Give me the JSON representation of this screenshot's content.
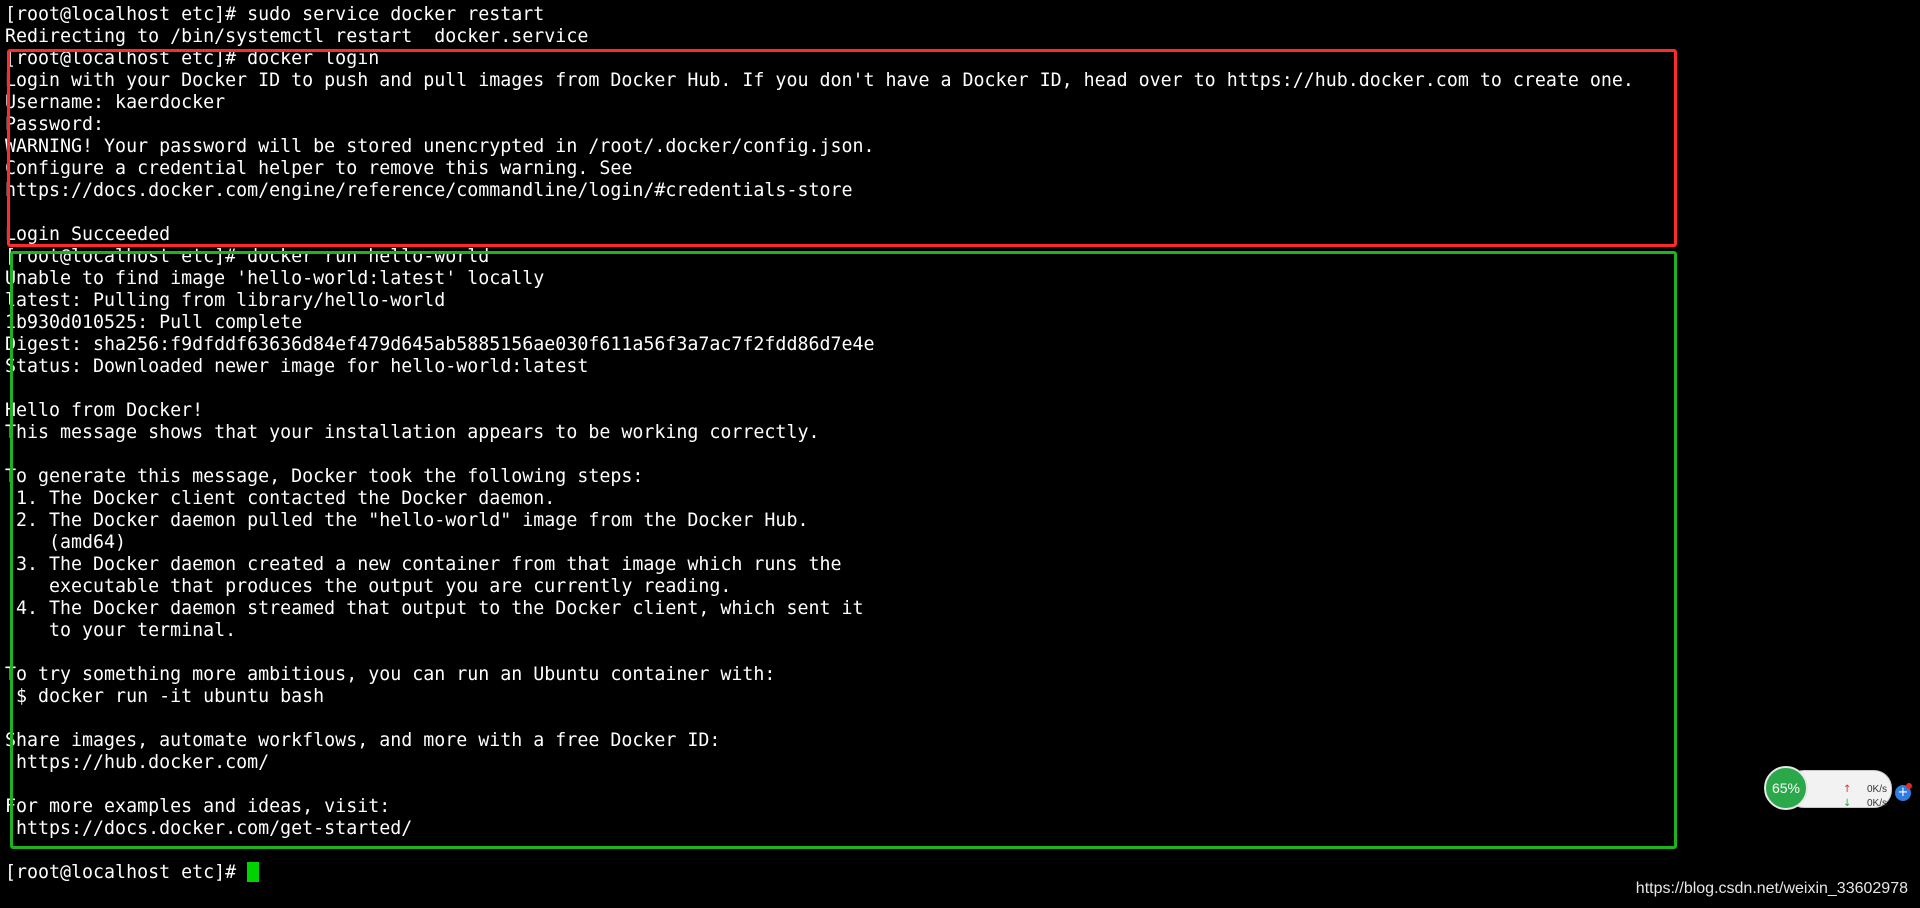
{
  "terminal": {
    "lines": [
      "[root@localhost etc]# sudo service docker restart",
      "Redirecting to /bin/systemctl restart  docker.service",
      "[root@localhost etc]# docker login",
      "Login with your Docker ID to push and pull images from Docker Hub. If you don't have a Docker ID, head over to https://hub.docker.com to create one.",
      "Username: kaerdocker",
      "Password:",
      "WARNING! Your password will be stored unencrypted in /root/.docker/config.json.",
      "Configure a credential helper to remove this warning. See",
      "https://docs.docker.com/engine/reference/commandline/login/#credentials-store",
      "",
      "Login Succeeded",
      "[root@localhost etc]# docker run hello-world",
      "Unable to find image 'hello-world:latest' locally",
      "latest: Pulling from library/hello-world",
      "1b930d010525: Pull complete",
      "Digest: sha256:f9dfddf63636d84ef479d645ab5885156ae030f611a56f3a7ac7f2fdd86d7e4e",
      "Status: Downloaded newer image for hello-world:latest",
      "",
      "Hello from Docker!",
      "This message shows that your installation appears to be working correctly.",
      "",
      "To generate this message, Docker took the following steps:",
      " 1. The Docker client contacted the Docker daemon.",
      " 2. The Docker daemon pulled the \"hello-world\" image from the Docker Hub.",
      "    (amd64)",
      " 3. The Docker daemon created a new container from that image which runs the",
      "    executable that produces the output you are currently reading.",
      " 4. The Docker daemon streamed that output to the Docker client, which sent it",
      "    to your terminal.",
      "",
      "To try something more ambitious, you can run an Ubuntu container with:",
      " $ docker run -it ubuntu bash",
      "",
      "Share images, automate workflows, and more with a free Docker ID:",
      " https://hub.docker.com/",
      "",
      "For more examples and ideas, visit:",
      " https://docs.docker.com/get-started/",
      ""
    ],
    "prompt": "[root@localhost etc]# ",
    "text_color": "#ffffff",
    "background_color": "#000000",
    "cursor_color": "#00d400"
  },
  "annotations": {
    "red_box_color": "#ff2a2a",
    "green_box_color": "#1db31d"
  },
  "network_widget": {
    "percent": "65%",
    "upload_speed": "0K/s",
    "download_speed": "0K/s",
    "icons": [
      "upload-arrow-icon",
      "download-arrow-icon",
      "plus-icon"
    ]
  },
  "watermark": {
    "text": "https://blog.csdn.net/weixin_33602978"
  }
}
